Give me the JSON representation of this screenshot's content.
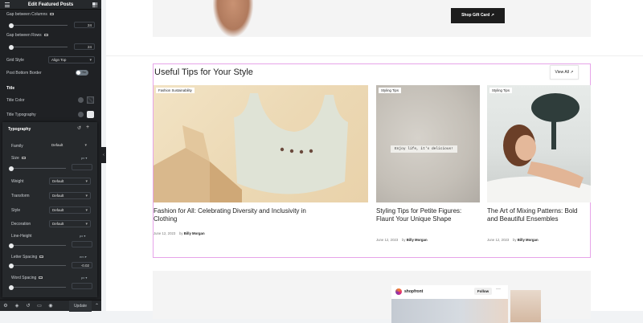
{
  "editor": {
    "title": "Edit Featured Posts",
    "gap_columns": {
      "label": "Gap between Columns",
      "value": "24",
      "level": 0.1
    },
    "gap_rows": {
      "label": "Gap between Rows",
      "value": "24",
      "level": 0.1
    },
    "grid_style": {
      "label": "Grid Style",
      "value": "Align Top"
    },
    "post_bottom_border": {
      "label": "Post Bottom Border",
      "toggle": "No"
    },
    "title_section": "Title",
    "title_color": "Title Color",
    "title_typography": "Title Typography",
    "typography": {
      "heading": "Typography",
      "family": {
        "label": "Family",
        "value": "Default"
      },
      "size": {
        "label": "Size",
        "unit": "px",
        "level": 0.0
      },
      "weight": {
        "label": "Weight",
        "value": "Default"
      },
      "transform": {
        "label": "Transform",
        "value": "Default"
      },
      "style": {
        "label": "Style",
        "value": "Default"
      },
      "decoration": {
        "label": "Decoration",
        "value": "Default"
      },
      "line_height": {
        "label": "Line-Height",
        "unit": "px",
        "level": 0.0
      },
      "letter_spacing": {
        "label": "Letter Spacing",
        "unit": "em",
        "value": "-0.02",
        "level": 0.0
      },
      "word_spacing": {
        "label": "Word Spacing",
        "unit": "px",
        "level": 0.0
      }
    },
    "footer": {
      "update": "Update"
    }
  },
  "page": {
    "gift_button": "Shop Gift Card ↗",
    "section_title": "Useful Tips for Your Style",
    "view_all": "View All ↗",
    "cards": [
      {
        "tag": "Fashion Sustainability",
        "title": "Fashion for All: Celebrating Diversity and Inclusivity in Clothing",
        "date": "June 12, 2023",
        "by": "by",
        "author": "Billy Morgan"
      },
      {
        "tag": "Styling Tips",
        "title": "Styling Tips for Petite Figures: Flaunt Your Unique Shape",
        "date": "June 12, 2023",
        "by": "by",
        "author": "Billy Morgan",
        "note": "Enjoy life, it's delicious!"
      },
      {
        "tag": "Styling Tips",
        "title": "The Art of Mixing Patterns: Bold and Beautiful Ensembles",
        "date": "June 12, 2023",
        "by": "by",
        "author": "Billy Morgan"
      }
    ],
    "instagram": {
      "account": "shopfront",
      "follow": "Follow",
      "more": "···"
    }
  }
}
